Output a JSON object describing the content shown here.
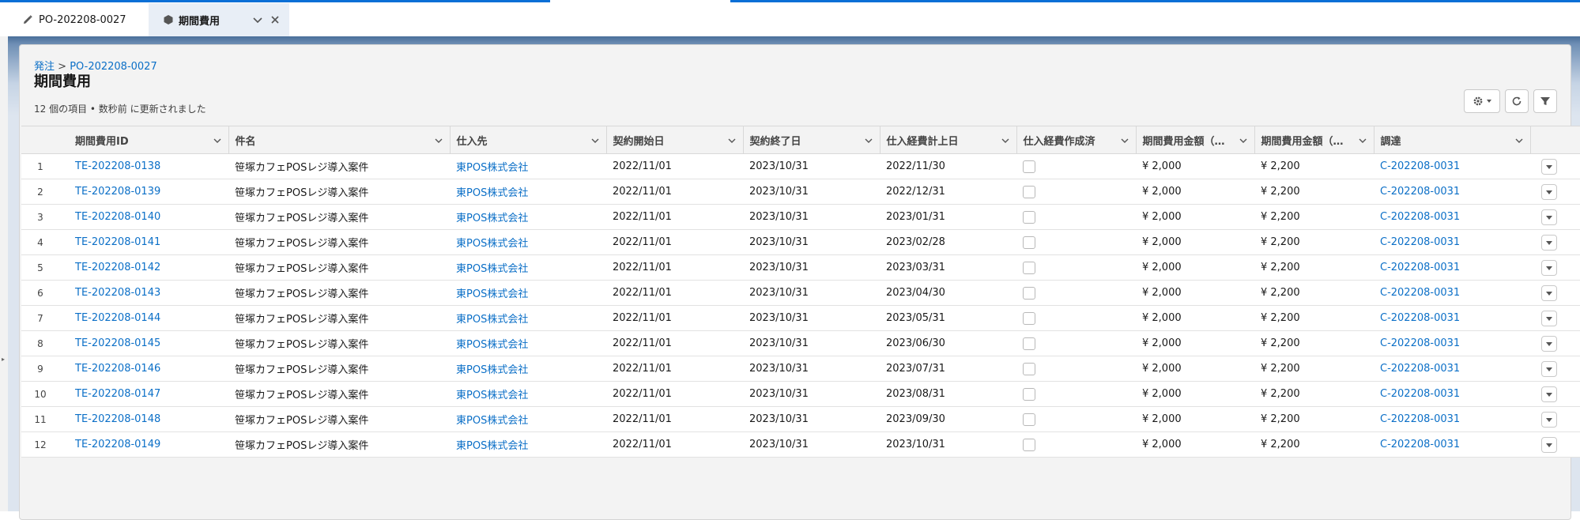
{
  "tabs": [
    {
      "label": "PO-202208-0027",
      "icon": "pencil-icon"
    },
    {
      "label": "期間費用",
      "icon": "hexagon-icon"
    }
  ],
  "breadcrumb": {
    "parent": "発注",
    "separator": ">",
    "current": "PO-202208-0027"
  },
  "page_title": "期間費用",
  "status_text": "12 個の項目 • 数秒前 に更新されました",
  "columns": [
    "期間費用ID",
    "件名",
    "仕入先",
    "契約開始日",
    "契約終了日",
    "仕入経費計上日",
    "仕入経費作成済",
    "期間費用金額（…",
    "期間費用金額（…",
    "調達"
  ],
  "rows": [
    {
      "num": "1",
      "id": "TE-202208-0138",
      "subject": "笹塚カフェPOSレジ導入案件",
      "vendor": "東POS株式会社",
      "start": "2022/11/01",
      "end": "2023/10/31",
      "posted": "2022/11/30",
      "amount1": "¥ 2,000",
      "amount2": "¥ 2,200",
      "procurement": "C-202208-0031"
    },
    {
      "num": "2",
      "id": "TE-202208-0139",
      "subject": "笹塚カフェPOSレジ導入案件",
      "vendor": "東POS株式会社",
      "start": "2022/11/01",
      "end": "2023/10/31",
      "posted": "2022/12/31",
      "amount1": "¥ 2,000",
      "amount2": "¥ 2,200",
      "procurement": "C-202208-0031"
    },
    {
      "num": "3",
      "id": "TE-202208-0140",
      "subject": "笹塚カフェPOSレジ導入案件",
      "vendor": "東POS株式会社",
      "start": "2022/11/01",
      "end": "2023/10/31",
      "posted": "2023/01/31",
      "amount1": "¥ 2,000",
      "amount2": "¥ 2,200",
      "procurement": "C-202208-0031"
    },
    {
      "num": "4",
      "id": "TE-202208-0141",
      "subject": "笹塚カフェPOSレジ導入案件",
      "vendor": "東POS株式会社",
      "start": "2022/11/01",
      "end": "2023/10/31",
      "posted": "2023/02/28",
      "amount1": "¥ 2,000",
      "amount2": "¥ 2,200",
      "procurement": "C-202208-0031"
    },
    {
      "num": "5",
      "id": "TE-202208-0142",
      "subject": "笹塚カフェPOSレジ導入案件",
      "vendor": "東POS株式会社",
      "start": "2022/11/01",
      "end": "2023/10/31",
      "posted": "2023/03/31",
      "amount1": "¥ 2,000",
      "amount2": "¥ 2,200",
      "procurement": "C-202208-0031"
    },
    {
      "num": "6",
      "id": "TE-202208-0143",
      "subject": "笹塚カフェPOSレジ導入案件",
      "vendor": "東POS株式会社",
      "start": "2022/11/01",
      "end": "2023/10/31",
      "posted": "2023/04/30",
      "amount1": "¥ 2,000",
      "amount2": "¥ 2,200",
      "procurement": "C-202208-0031"
    },
    {
      "num": "7",
      "id": "TE-202208-0144",
      "subject": "笹塚カフェPOSレジ導入案件",
      "vendor": "東POS株式会社",
      "start": "2022/11/01",
      "end": "2023/10/31",
      "posted": "2023/05/31",
      "amount1": "¥ 2,000",
      "amount2": "¥ 2,200",
      "procurement": "C-202208-0031"
    },
    {
      "num": "8",
      "id": "TE-202208-0145",
      "subject": "笹塚カフェPOSレジ導入案件",
      "vendor": "東POS株式会社",
      "start": "2022/11/01",
      "end": "2023/10/31",
      "posted": "2023/06/30",
      "amount1": "¥ 2,000",
      "amount2": "¥ 2,200",
      "procurement": "C-202208-0031"
    },
    {
      "num": "9",
      "id": "TE-202208-0146",
      "subject": "笹塚カフェPOSレジ導入案件",
      "vendor": "東POS株式会社",
      "start": "2022/11/01",
      "end": "2023/10/31",
      "posted": "2023/07/31",
      "amount1": "¥ 2,000",
      "amount2": "¥ 2,200",
      "procurement": "C-202208-0031"
    },
    {
      "num": "10",
      "id": "TE-202208-0147",
      "subject": "笹塚カフェPOSレジ導入案件",
      "vendor": "東POS株式会社",
      "start": "2022/11/01",
      "end": "2023/10/31",
      "posted": "2023/08/31",
      "amount1": "¥ 2,000",
      "amount2": "¥ 2,200",
      "procurement": "C-202208-0031"
    },
    {
      "num": "11",
      "id": "TE-202208-0148",
      "subject": "笹塚カフェPOSレジ導入案件",
      "vendor": "東POS株式会社",
      "start": "2022/11/01",
      "end": "2023/10/31",
      "posted": "2023/09/30",
      "amount1": "¥ 2,000",
      "amount2": "¥ 2,200",
      "procurement": "C-202208-0031"
    },
    {
      "num": "12",
      "id": "TE-202208-0149",
      "subject": "笹塚カフェPOSレジ導入案件",
      "vendor": "東POS株式会社",
      "start": "2022/11/01",
      "end": "2023/10/31",
      "posted": "2023/10/31",
      "amount1": "¥ 2,000",
      "amount2": "¥ 2,200",
      "procurement": "C-202208-0031"
    }
  ],
  "toolbar": {
    "settings_icon": "gear-icon",
    "refresh_icon": "refresh-icon",
    "filter_icon": "filter-icon"
  },
  "colors": {
    "link": "#0b6fc7",
    "accent": "#0a6fd6",
    "banner": "#4a6f9a"
  }
}
